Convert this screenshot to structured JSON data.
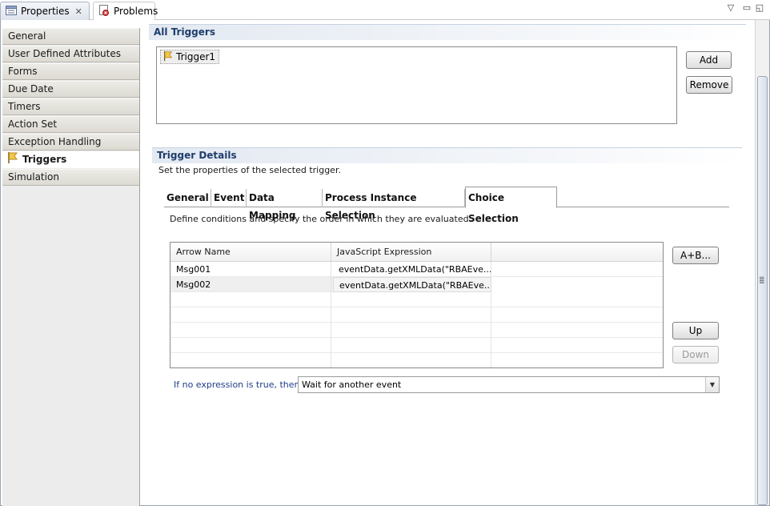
{
  "view_tabs": [
    {
      "label": "Properties",
      "icon": "properties-icon",
      "closable": true,
      "active": true
    },
    {
      "label": "Problems",
      "icon": "problems-icon",
      "active": false
    }
  ],
  "view_controls": {
    "menu_icon": "view-menu-icon",
    "minimize_icon": "minimize-icon",
    "maximize_icon": "maximize-icon"
  },
  "nav": {
    "items": [
      {
        "label": "General"
      },
      {
        "label": "User Defined Attributes"
      },
      {
        "label": "Forms"
      },
      {
        "label": "Due Date"
      },
      {
        "label": "Timers"
      },
      {
        "label": "Action Set"
      },
      {
        "label": "Exception Handling"
      },
      {
        "label": "Triggers",
        "selected": true,
        "icon": "trigger-flag-icon"
      },
      {
        "label": "Simulation"
      }
    ]
  },
  "all_triggers": {
    "title": "All Triggers",
    "items": [
      {
        "label": "Trigger1",
        "icon": "trigger-flag-icon"
      }
    ],
    "add_label": "Add",
    "remove_label": "Remove"
  },
  "trigger_details": {
    "title": "Trigger Details",
    "description": "Set the properties of the selected trigger.",
    "tabs": [
      {
        "label": "General"
      },
      {
        "label": "Event"
      },
      {
        "label": "Data Mapping"
      },
      {
        "label": "Process Instance Selection"
      },
      {
        "label": "Choice Selection",
        "active": true
      }
    ],
    "choice_selection": {
      "instructions": "Define conditions and specify the order in which they are evaluated:",
      "columns": [
        "Arrow Name",
        "JavaScript Expression",
        ""
      ],
      "rows": [
        {
          "arrow_name": "Msg001",
          "expression": "eventData.getXMLData(\"RBAEve..."
        },
        {
          "arrow_name": "Msg002",
          "expression": "eventData.getXMLData(\"RBAEve...",
          "selected": true
        }
      ],
      "expression_builder_label": "A+B...",
      "up_label": "Up",
      "down_label": "Down",
      "down_enabled": false,
      "fallback_label": "If no expression is true, then:",
      "fallback_value": "Wait for another event"
    }
  },
  "colors": {
    "section_header_text": "#1f3d6b",
    "link_label": "#1f3d8a",
    "selected_row": "#efefef"
  }
}
